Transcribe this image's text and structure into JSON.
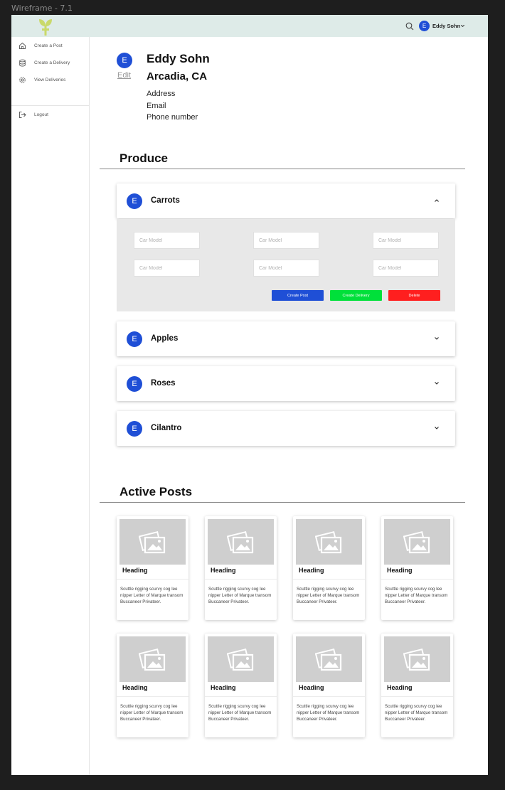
{
  "frame": {
    "label": "Wireframe - 7.1"
  },
  "topbar": {
    "icons": {
      "logo": "plant-logo",
      "search": "search-icon",
      "chevron": "chevron-down-icon"
    },
    "user_initial": "E",
    "user_name": "Eddy Sohn"
  },
  "sidebar": {
    "items": [
      {
        "label": "Create a Post",
        "icon": "home-icon"
      },
      {
        "label": "Create a Delivery",
        "icon": "database-icon"
      },
      {
        "label": "View Deliveries",
        "icon": "gear-icon"
      },
      {
        "label": "Logout",
        "icon": "logout-icon"
      }
    ]
  },
  "profile": {
    "initial": "E",
    "edit_label": "Edit",
    "name": "Eddy Sohn",
    "location": "Arcadia, CA",
    "lines": [
      "Address",
      "Email",
      "Phone number"
    ]
  },
  "produce": {
    "title": "Produce",
    "items": [
      {
        "initial": "E",
        "name": "Carrots",
        "expanded": true
      },
      {
        "initial": "E",
        "name": "Apples",
        "expanded": false
      },
      {
        "initial": "E",
        "name": "Roses",
        "expanded": false
      },
      {
        "initial": "E",
        "name": "Cilantro",
        "expanded": false
      }
    ],
    "fields_placeholder": "Car Model",
    "buttons": {
      "create_post": "Create Post",
      "create_delivery": "Create Delivery",
      "delete": "Delete"
    }
  },
  "colors": {
    "primary": "#1f4fd6",
    "create_delivery": "#00e03a",
    "delete": "#ff1f1f",
    "topbar": "#deebe8"
  },
  "active_posts": {
    "title": "Active Posts",
    "posts": [
      {
        "heading": "Heading",
        "body": "Scuttle rigging scurvy cog lee nipper Letter of Marque transom Buccaneer Privateer."
      },
      {
        "heading": "Heading",
        "body": "Scuttle rigging scurvy cog lee nipper Letter of Marque transom Buccaneer Privateer."
      },
      {
        "heading": "Heading",
        "body": "Scuttle rigging scurvy cog lee nipper Letter of Marque transom Buccaneer Privateer."
      },
      {
        "heading": "Heading",
        "body": "Scuttle rigging scurvy cog lee nipper Letter of Marque transom Buccaneer Privateer."
      },
      {
        "heading": "Heading",
        "body": "Scuttle rigging scurvy cog lee nipper Letter of Marque transom Buccaneer Privateer."
      },
      {
        "heading": "Heading",
        "body": "Scuttle rigging scurvy cog lee nipper Letter of Marque transom Buccaneer Privateer."
      },
      {
        "heading": "Heading",
        "body": "Scuttle rigging scurvy cog lee nipper Letter of Marque transom Buccaneer Privateer."
      },
      {
        "heading": "Heading",
        "body": "Scuttle rigging scurvy cog lee nipper Letter of Marque transom Buccaneer Privateer."
      }
    ]
  }
}
